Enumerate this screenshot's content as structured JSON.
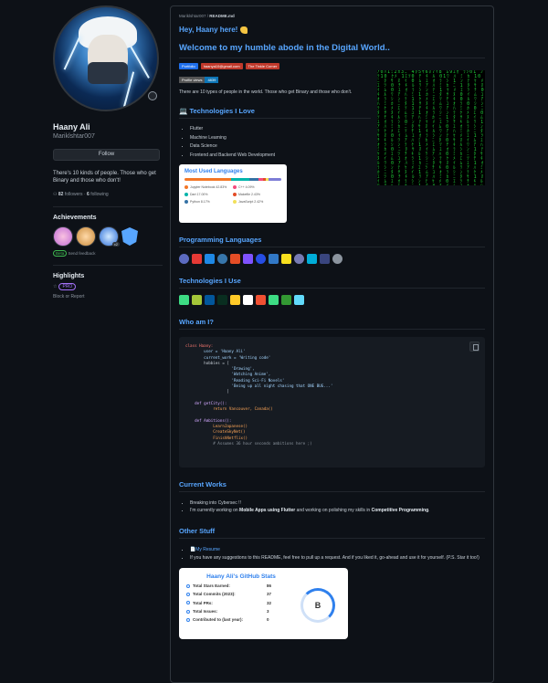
{
  "profile": {
    "name": "Haany Ali",
    "login": "Mariklshtar007",
    "follow_label": "Follow",
    "bio": "There's 10 kinds of people. Those who get Binary and those who don't!",
    "followers_count": "82",
    "followers_label": "followers",
    "following_count": "6",
    "following_label": "following",
    "achievements_title": "Achievements",
    "achievement_badge_count": "x2",
    "beta_tag": "Beta",
    "beta_text": "Send feedback",
    "highlights_title": "Highlights",
    "pro_tag": "PRO",
    "block_text": "Block or Report"
  },
  "readme": {
    "file_path_prefix": "Mariklshtar007 / ",
    "file_path_name": "README.md",
    "hey": "Hey, Haany here!",
    "welcome": "Welcome to my humble abode in the Digital World..",
    "shields": [
      {
        "label": "Portfolio",
        "color": "#1f6feb"
      },
      {
        "label": "haanya10@gmail.com",
        "color": "#c0392b"
      },
      {
        "label": "The Tinkle Corner",
        "color": "#c0392b"
      }
    ],
    "views_label": "Profile views",
    "views_count": "4839",
    "types": "There are 10 types of people in the world. Those who get Binary and those who don't.",
    "tech_love_title": "Technologies I Love",
    "tech_love": [
      "Flutter",
      "Machine Learning",
      "Data Science",
      "Frontend and Backend Web Development"
    ],
    "langs_title": "Most Used Languages",
    "langs": [
      {
        "name": "Jupyter Notebook 42.83%",
        "color": "#f37626"
      },
      {
        "name": "C++ 4.09%",
        "color": "#f34b7d"
      },
      {
        "name": "Dart 17.00%",
        "color": "#00b4ab"
      },
      {
        "name": "Makefile 2.43%",
        "color": "#e34c26"
      },
      {
        "name": "Python 8.17%",
        "color": "#3572a5"
      },
      {
        "name": "JavaScript 2.42%",
        "color": "#f1e05a"
      }
    ],
    "prog_lang_title": "Programming Languages",
    "prog_icons": [
      "c-icon",
      "cpp-icon",
      "dart-icon",
      "python-icon",
      "html-icon",
      "kotlin-icon",
      "css-icon",
      "typescript-icon",
      "javascript-icon",
      "php-icon",
      "go-icon",
      "perl-icon",
      "regex-icon"
    ],
    "tech_use_title": "Technologies I Use",
    "tech_icons": [
      "android-studio-icon",
      "android-icon",
      "flutter-icon",
      "django-icon",
      "firebase-icon",
      "unity-icon",
      "git-icon",
      "android-dev-icon",
      "nodejs-icon",
      "react-icon"
    ],
    "who_title": "Who am I?",
    "code_lines": [
      {
        "t": "class Haany:",
        "c": "kw"
      },
      {
        "t": "        user = 'Haany Ali'",
        "c": "st"
      },
      {
        "t": "        current_work = 'Writing code'",
        "c": "st"
      },
      {
        "t": "        hobbies = [",
        "c": ""
      },
      {
        "t": "                    'Drawing',",
        "c": "st"
      },
      {
        "t": "                    'Watching Anime',",
        "c": "st"
      },
      {
        "t": "                    'Reading Sci-Fi Novels'",
        "c": "st"
      },
      {
        "t": "                    'Being up all night chasing that ONE BUG...'",
        "c": "st"
      },
      {
        "t": "                  ]",
        "c": ""
      },
      {
        "t": "",
        "c": ""
      },
      {
        "t": "    def getCity():",
        "c": "fn"
      },
      {
        "t": "            return Vancouver, Canada()",
        "c": "yl"
      },
      {
        "t": "",
        "c": ""
      },
      {
        "t": "    def Ambitions():",
        "c": "fn"
      },
      {
        "t": "            LearnJapanese()",
        "c": "yl"
      },
      {
        "t": "            CreateSkyNet()",
        "c": "yl"
      },
      {
        "t": "            FinishNetflix()",
        "c": "yl"
      },
      {
        "t": "            # Assumes 36 hour seconds ambitions here ;)",
        "c": "gr"
      }
    ],
    "current_title": "Current Works",
    "current": [
      {
        "pre": "Breaking into Cybersec !!",
        "bold": "",
        "mid": "",
        "bold2": "",
        "post": ""
      },
      {
        "pre": "I'm currently working on ",
        "bold": "Mobile Apps using Flutter",
        "mid": " and working on polishing my skills in ",
        "bold2": "Competitive Programming",
        "post": "."
      }
    ],
    "other_title": "Other Stuff",
    "resume_link": "My Resume",
    "suggest": "If you have any suggestions to this README, feel free to pull up a request. And if you liked it, go-ahead and use it for yourself. (P.S. Star it too!)",
    "stats_title": "Haany Ali's GitHub Stats",
    "stats": [
      {
        "label": "Total Stars Earned:",
        "value": "86"
      },
      {
        "label": "Total Commits (2023):",
        "value": "37"
      },
      {
        "label": "Total PRs:",
        "value": "32"
      },
      {
        "label": "Total Issues:",
        "value": "3"
      },
      {
        "label": "Contributed to (last year):",
        "value": "0"
      }
    ],
    "grade": "B"
  }
}
